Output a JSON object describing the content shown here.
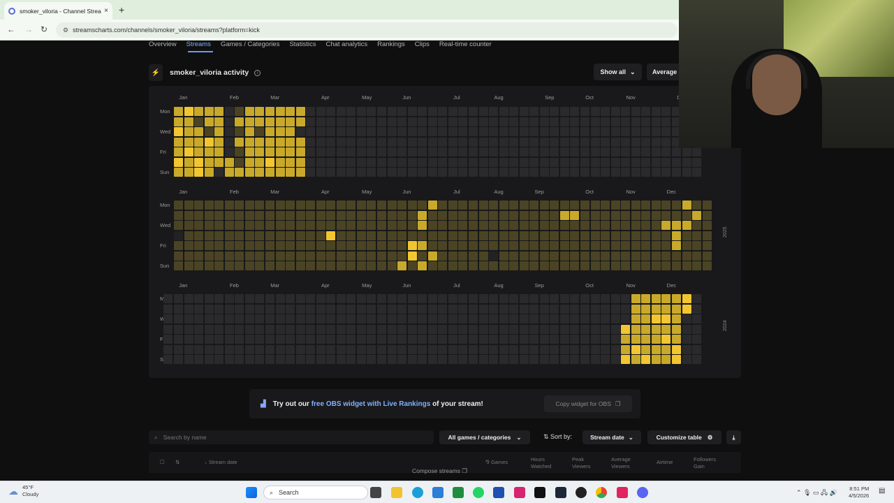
{
  "browser": {
    "tab_title": "smoker_viloria - Channel Stream",
    "tab_close": "×",
    "new_tab": "+",
    "url": "streamscharts.com/channels/smoker_viloria/streams?platform=kick"
  },
  "subnav": {
    "items": [
      "Overview",
      "Streams",
      "Games / Categories",
      "Statistics",
      "Chat analytics",
      "Rankings",
      "Clips",
      "Real-time counter"
    ],
    "active": "Streams"
  },
  "activity": {
    "title": "smoker_viloria activity",
    "show_all": "Show all",
    "average": "Average",
    "day_labels": [
      "Mon",
      "Wed",
      "Fri",
      "Sun"
    ],
    "years": [
      "2025",
      "2024"
    ],
    "rows": [
      {
        "months": [
          "Jan",
          "Feb",
          "Mar",
          "Apr",
          "May",
          "Jun",
          "Jul",
          "Aug",
          "Sep",
          "Oct",
          "Nov",
          "D"
        ],
        "month_weeks": [
          0.5,
          5.5,
          9.5,
          14.5,
          18.5,
          22.5,
          27.5,
          31.5,
          36.5,
          40.5,
          44.5,
          49.5
        ],
        "first_week": 1,
        "last_week": 52,
        "active": {
          "intensity_note": "levels 0-3",
          "cells": [
            [
              1,
              0,
              2
            ],
            [
              2,
              0,
              3
            ],
            [
              3,
              0,
              2
            ],
            [
              4,
              0,
              2
            ],
            [
              5,
              0,
              2
            ],
            [
              7,
              0,
              1
            ],
            [
              8,
              0,
              2
            ],
            [
              9,
              0,
              2
            ],
            [
              10,
              0,
              2
            ],
            [
              11,
              0,
              2
            ],
            [
              12,
              0,
              2
            ],
            [
              13,
              0,
              2
            ],
            [
              1,
              1,
              2
            ],
            [
              2,
              1,
              2
            ],
            [
              3,
              1,
              1
            ],
            [
              4,
              1,
              2
            ],
            [
              5,
              1,
              2
            ],
            [
              7,
              1,
              2
            ],
            [
              8,
              1,
              2
            ],
            [
              9,
              1,
              2
            ],
            [
              10,
              1,
              2
            ],
            [
              11,
              1,
              2
            ],
            [
              12,
              1,
              2
            ],
            [
              13,
              1,
              2
            ],
            [
              1,
              2,
              3
            ],
            [
              2,
              2,
              2
            ],
            [
              3,
              2,
              2
            ],
            [
              4,
              2,
              1
            ],
            [
              5,
              2,
              2
            ],
            [
              7,
              2,
              1
            ],
            [
              8,
              2,
              2
            ],
            [
              9,
              2,
              1
            ],
            [
              10,
              2,
              2
            ],
            [
              11,
              2,
              2
            ],
            [
              12,
              2,
              2
            ],
            [
              0,
              3,
              2
            ],
            [
              1,
              3,
              2
            ],
            [
              2,
              3,
              2
            ],
            [
              3,
              3,
              2
            ],
            [
              4,
              3,
              3
            ],
            [
              5,
              3,
              2
            ],
            [
              7,
              3,
              2
            ],
            [
              8,
              3,
              2
            ],
            [
              9,
              3,
              2
            ],
            [
              10,
              3,
              2
            ],
            [
              11,
              3,
              2
            ],
            [
              12,
              3,
              2
            ],
            [
              13,
              3,
              2
            ],
            [
              0,
              4,
              2
            ],
            [
              1,
              4,
              2
            ],
            [
              2,
              4,
              3
            ],
            [
              3,
              4,
              2
            ],
            [
              4,
              4,
              2
            ],
            [
              5,
              4,
              2
            ],
            [
              7,
              4,
              1
            ],
            [
              8,
              4,
              2
            ],
            [
              9,
              4,
              2
            ],
            [
              10,
              4,
              2
            ],
            [
              11,
              4,
              2
            ],
            [
              12,
              4,
              2
            ],
            [
              13,
              4,
              2
            ],
            [
              0,
              5,
              2
            ],
            [
              1,
              5,
              3
            ],
            [
              2,
              5,
              2
            ],
            [
              3,
              5,
              3
            ],
            [
              4,
              5,
              2
            ],
            [
              5,
              5,
              2
            ],
            [
              6,
              5,
              2
            ],
            [
              7,
              5,
              1
            ],
            [
              8,
              5,
              2
            ],
            [
              9,
              5,
              2
            ],
            [
              10,
              5,
              3
            ],
            [
              11,
              5,
              2
            ],
            [
              12,
              5,
              2
            ],
            [
              13,
              5,
              2
            ],
            [
              0,
              6,
              2
            ],
            [
              1,
              6,
              2
            ],
            [
              2,
              6,
              2
            ],
            [
              3,
              6,
              3
            ],
            [
              4,
              6,
              2
            ],
            [
              6,
              6,
              2
            ],
            [
              7,
              6,
              2
            ],
            [
              8,
              6,
              2
            ],
            [
              9,
              6,
              2
            ],
            [
              10,
              6,
              2
            ],
            [
              11,
              6,
              2
            ],
            [
              12,
              6,
              2
            ],
            [
              13,
              6,
              2
            ]
          ]
        }
      },
      {
        "months": [
          "Jan",
          "Feb",
          "Mar",
          "Apr",
          "May",
          "Jun",
          "Jul",
          "Aug",
          "Sep",
          "Oct",
          "Nov",
          "Dec"
        ],
        "month_weeks": [
          0.5,
          5.5,
          9.5,
          14.5,
          18.5,
          22.5,
          27.5,
          31.5,
          35.5,
          40.5,
          44.5,
          48.5
        ],
        "first_week": 1,
        "last_week": 53,
        "active": {
          "cells": [
            [
              26,
              0,
              2
            ],
            [
              51,
              0,
              2
            ],
            [
              25,
              1,
              2
            ],
            [
              39,
              1,
              2
            ],
            [
              40,
              1,
              2
            ],
            [
              52,
              1,
              2
            ],
            [
              25,
              2,
              2
            ],
            [
              49,
              2,
              2
            ],
            [
              50,
              2,
              2
            ],
            [
              51,
              2,
              2
            ],
            [
              16,
              3,
              3
            ],
            [
              50,
              3,
              2
            ],
            [
              24,
              4,
              3
            ],
            [
              25,
              4,
              2
            ],
            [
              50,
              4,
              2
            ],
            [
              24,
              5,
              3
            ],
            [
              26,
              5,
              2
            ],
            [
              23,
              6,
              2
            ],
            [
              25,
              6,
              2
            ]
          ],
          "dim_cells": [
            [
              1,
              3
            ],
            [
              32,
              5
            ]
          ],
          "base_level": 1
        }
      },
      {
        "months": [
          "Jan",
          "Feb",
          "Mar",
          "Apr",
          "May",
          "Jun",
          "Jul",
          "Aug",
          "Sep",
          "Oct",
          "Nov",
          "Dec"
        ],
        "month_weeks": [
          0.5,
          5.5,
          9.5,
          14.5,
          18.5,
          22.5,
          27.5,
          31.5,
          35.5,
          40.5,
          44.5,
          48.5
        ],
        "first_week": 0,
        "last_week": 52,
        "active": {
          "cells": [
            [
              46,
              0,
              2
            ],
            [
              47,
              0,
              2
            ],
            [
              48,
              0,
              2
            ],
            [
              49,
              0,
              2
            ],
            [
              50,
              0,
              2
            ],
            [
              51,
              0,
              3
            ],
            [
              46,
              1,
              2
            ],
            [
              47,
              1,
              2
            ],
            [
              48,
              1,
              2
            ],
            [
              49,
              1,
              2
            ],
            [
              50,
              1,
              2
            ],
            [
              51,
              1,
              3
            ],
            [
              46,
              2,
              2
            ],
            [
              47,
              2,
              2
            ],
            [
              48,
              2,
              3
            ],
            [
              49,
              2,
              3
            ],
            [
              50,
              2,
              2
            ],
            [
              45,
              3,
              3
            ],
            [
              46,
              3,
              2
            ],
            [
              47,
              3,
              2
            ],
            [
              48,
              3,
              2
            ],
            [
              49,
              3,
              2
            ],
            [
              50,
              3,
              2
            ],
            [
              45,
              4,
              2
            ],
            [
              46,
              4,
              2
            ],
            [
              47,
              4,
              2
            ],
            [
              48,
              4,
              2
            ],
            [
              49,
              4,
              3
            ],
            [
              50,
              4,
              2
            ],
            [
              45,
              5,
              2
            ],
            [
              46,
              5,
              3
            ],
            [
              47,
              5,
              2
            ],
            [
              48,
              5,
              2
            ],
            [
              49,
              5,
              2
            ],
            [
              50,
              5,
              3
            ],
            [
              45,
              6,
              3
            ],
            [
              46,
              6,
              2
            ],
            [
              47,
              6,
              3
            ],
            [
              48,
              6,
              2
            ],
            [
              49,
              6,
              2
            ],
            [
              50,
              6,
              3
            ]
          ]
        }
      }
    ]
  },
  "obs_banner": {
    "prefix": "Try out our ",
    "link": "free OBS widget with Live Rankings",
    "suffix": " of your stream!",
    "copy_button": "Copy widget for OBS"
  },
  "controls": {
    "search_placeholder": "Search by name",
    "games_filter": "All games / categories",
    "sort_label": "Sort by:",
    "sort_value": "Stream date",
    "customize": "Customize table"
  },
  "table": {
    "headers": {
      "stream_date": "Stream date",
      "compose": "Compose streams",
      "games": "Games",
      "hours_watched": "Hours Watched",
      "peak_viewers": "Peak Viewers",
      "avg_viewers": "Average Viewers",
      "airtime": "Airtime",
      "followers_gain": "Followers Gain"
    }
  },
  "taskbar": {
    "temp": "45°F",
    "weather": "Cloudy",
    "search": "Search",
    "time": "8:51 PM",
    "date": "4/5/2026"
  },
  "colors": {
    "level0": "#2a2a2c",
    "level1": "#4b4424",
    "level2": "#c9a92a",
    "level3": "#f2c630",
    "dim": "#222226",
    "accent": "#7fb1ff"
  }
}
